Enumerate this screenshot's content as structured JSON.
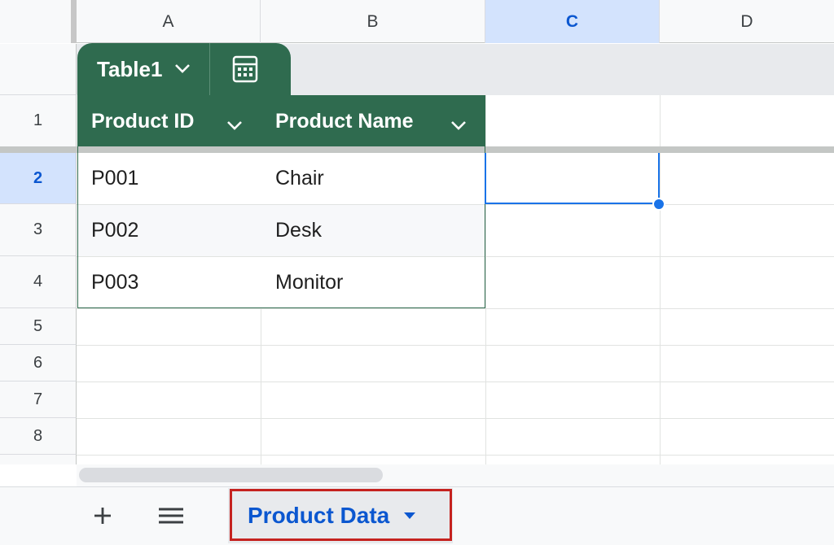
{
  "columns": [
    "A",
    "B",
    "C",
    "D"
  ],
  "rows": [
    "1",
    "2",
    "3",
    "4",
    "5",
    "6",
    "7",
    "8"
  ],
  "selected_cell": {
    "column": "C",
    "row": "2"
  },
  "table": {
    "name": "Table1",
    "headers": [
      "Product ID",
      "Product Name"
    ],
    "rows": [
      [
        "P001",
        "Chair"
      ],
      [
        "P002",
        "Desk"
      ],
      [
        "P003",
        "Monitor"
      ]
    ],
    "header_color": "#2f6b4f"
  },
  "sheet_tab": {
    "label": "Product Data"
  },
  "icons": {
    "chip_dropdown": "chevron-down-icon",
    "calc": "calculator-icon",
    "add_sheet": "plus-icon",
    "all_sheets": "menu-icon",
    "tab_menu": "triangle-down-icon"
  },
  "colors": {
    "accent": "#1a73e8",
    "selected_header_bg": "#d3e3fd",
    "annotation": "#c5221f"
  }
}
